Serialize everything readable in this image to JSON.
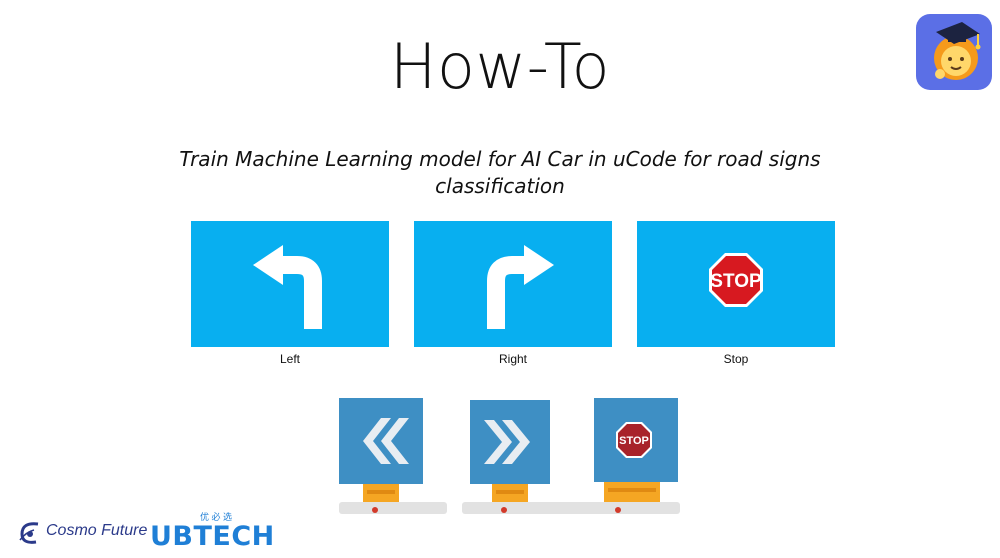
{
  "title": "How-To",
  "subtitle": "Train Machine Learning model for AI Car in uCode for road signs classification",
  "signs": [
    {
      "label": "Left",
      "icon": "left-turn-arrow-icon"
    },
    {
      "label": "Right",
      "icon": "right-turn-arrow-icon"
    },
    {
      "label": "Stop",
      "icon": "stop-sign-icon",
      "sign_text": "STOP"
    }
  ],
  "physical_signs": [
    {
      "icon": "double-chevron-left-icon"
    },
    {
      "icon": "double-chevron-right-icon"
    },
    {
      "icon": "stop-sign-icon",
      "sign_text": "STOP"
    }
  ],
  "brands": {
    "cosmo": "Cosmo Future",
    "ubtech": "UBTECH",
    "ubtech_cn": "优 必 选"
  },
  "colors": {
    "sign_blue": "#08aff0",
    "stop_red": "#d71920",
    "ubtech_blue": "#1f7fd6"
  }
}
